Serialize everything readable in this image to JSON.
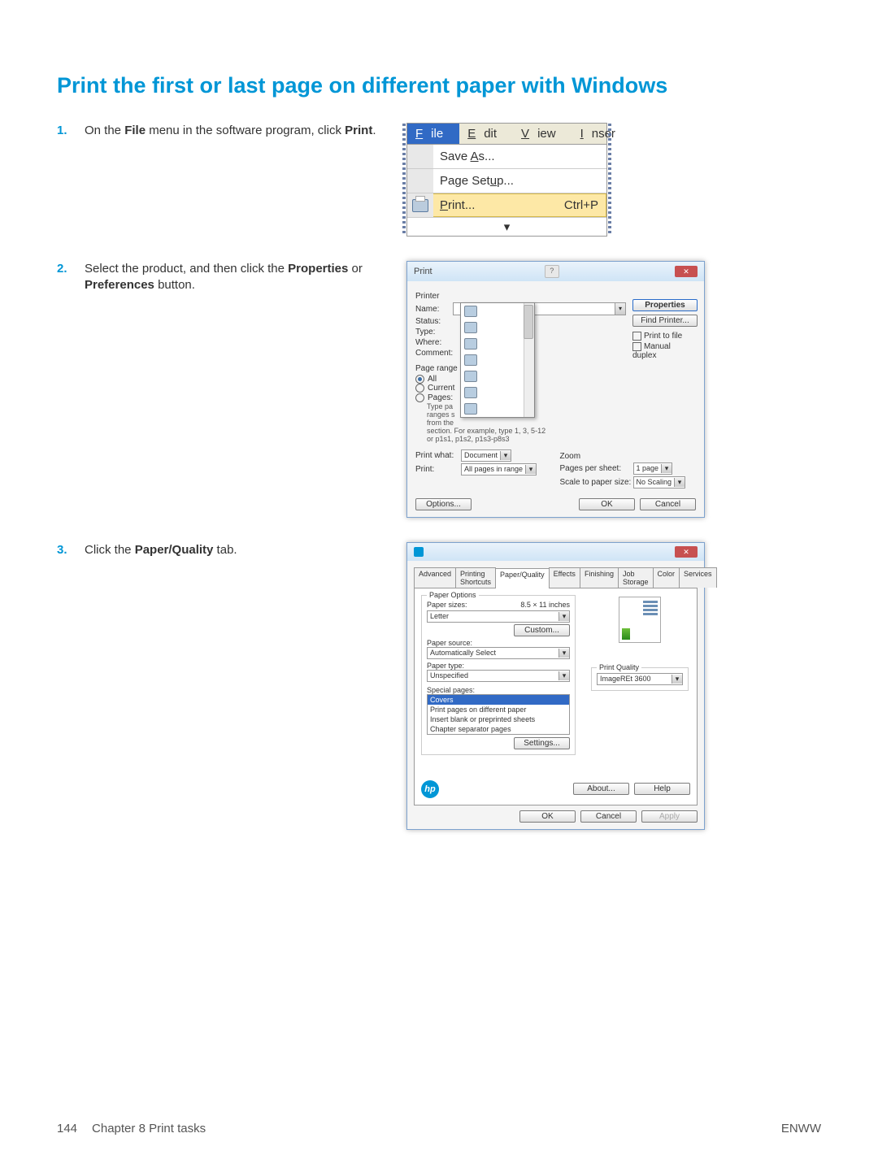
{
  "title": "Print the first or last page on different paper with Windows",
  "steps": {
    "s1": {
      "num": "1.",
      "pre": "On the ",
      "bold1": "File",
      "mid": " menu in the software program, click ",
      "bold2": "Print",
      "post": "."
    },
    "s2": {
      "num": "2.",
      "pre": "Select the product, and then click the ",
      "bold1": "Properties",
      "mid": " or ",
      "bold2": "Preferences",
      "post": " button."
    },
    "s3": {
      "num": "3.",
      "pre": "Click the ",
      "bold1": "Paper/Quality",
      "post": " tab."
    }
  },
  "menu": {
    "file": "File",
    "edit": "Edit",
    "view": "View",
    "inser": "Inser",
    "save_as": "Save As...",
    "page_setup": "Page Setup...",
    "print": "Print...",
    "print_sc": "Ctrl+P",
    "chev": "¦"
  },
  "print_dlg": {
    "title": "Print",
    "printer_section": "Printer",
    "name": "Name:",
    "status": "Status:",
    "type": "Type:",
    "where": "Where:",
    "comment": "Comment:",
    "properties": "Properties",
    "find_printer": "Find Printer...",
    "print_to_file": "Print to file",
    "manual_duplex": "Manual duplex",
    "page_range": "Page range",
    "all": "All",
    "current": "Current",
    "pages": "Pages:",
    "hint1": "Type pa",
    "hint2": "ranges s",
    "hint3": "from the",
    "hint4": "section. For example, type 1, 3, 5-12",
    "hint5": "or p1s1, p1s2, p1s3-p8s3",
    "print_what": "Print what:",
    "print_what_v": "Document",
    "print_lbl": "Print:",
    "print_v": "All pages in range",
    "zoom": "Zoom",
    "pps": "Pages per sheet:",
    "pps_v": "1 page",
    "sps": "Scale to paper size:",
    "sps_v": "No Scaling",
    "options": "Options...",
    "ok": "OK",
    "cancel": "Cancel"
  },
  "pq_dlg": {
    "tabs": [
      "Advanced",
      "Printing Shortcuts",
      "Paper/Quality",
      "Effects",
      "Finishing",
      "Job Storage",
      "Color",
      "Services"
    ],
    "paper_options": "Paper Options",
    "paper_sizes": "Paper sizes:",
    "paper_sizes_v": "8.5 × 11 inches",
    "letter": "Letter",
    "custom": "Custom...",
    "paper_source": "Paper source:",
    "paper_source_v": "Automatically Select",
    "paper_type": "Paper type:",
    "paper_type_v": "Unspecified",
    "special_pages": "Special pages:",
    "sp_items": [
      "Covers",
      "Print pages on different paper",
      "Insert blank or preprinted sheets",
      "Chapter separator pages"
    ],
    "settings": "Settings...",
    "print_quality": "Print Quality",
    "pq_v": "ImageREt 3600",
    "about": "About...",
    "help": "Help",
    "ok": "OK",
    "cancel": "Cancel",
    "apply": "Apply"
  },
  "footer": {
    "pagenum": "144",
    "chapter": "Chapter 8   Print tasks",
    "enww": "ENWW"
  }
}
